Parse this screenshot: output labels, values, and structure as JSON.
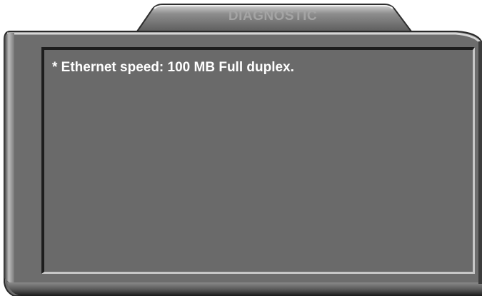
{
  "window": {
    "title": "DIAGNOSTIC"
  },
  "diagnostics": {
    "lines": [
      "* Ethernet speed: 100 MB Full duplex."
    ]
  }
}
